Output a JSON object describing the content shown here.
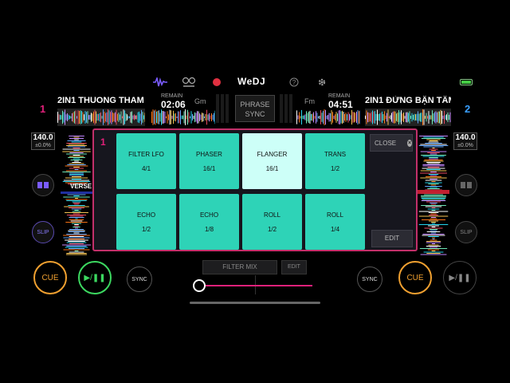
{
  "app": {
    "logo": "WeDJ"
  },
  "topbar": {
    "icons": [
      "waveform-icon",
      "automix-icon",
      "record-icon",
      "help-icon",
      "settings-icon",
      "battery-icon"
    ]
  },
  "deck1": {
    "number": "1",
    "title": "2IN1 THUONG THAM",
    "remain_label": "REMAIN",
    "remain_time": "02:06",
    "key": "Gm",
    "bpm": "140.0",
    "pitch": "±0.0%",
    "cue_label": "CUE",
    "play_label": "▶/❚❚",
    "sync_label": "SYNC",
    "slip_label": "SLIP",
    "section_label": "VERSE",
    "color": "#e0207a"
  },
  "deck2": {
    "number": "2",
    "title": "2IN1 ĐỪNG BẬN TÂM",
    "remain_label": "REMAIN",
    "remain_time": "04:51",
    "key": "Fm",
    "bpm": "140.0",
    "pitch": "±0.0%",
    "cue_label": "CUE",
    "play_label": "▶/❚❚",
    "sync_label": "SYNC",
    "slip_label": "SLIP",
    "color": "#3aa0ff"
  },
  "phrase_sync": {
    "line1": "PHRASE",
    "line2": "SYNC"
  },
  "fx_panel": {
    "deck": "1",
    "close_label": "CLOSE",
    "edit_label": "EDIT",
    "pads": [
      {
        "name": "FILTER LFO",
        "beat": "4/1",
        "active": false
      },
      {
        "name": "PHASER",
        "beat": "16/1",
        "active": false
      },
      {
        "name": "FLANGER",
        "beat": "16/1",
        "active": true
      },
      {
        "name": "TRANS",
        "beat": "1/2",
        "active": false
      },
      {
        "name": "ECHO",
        "beat": "1/2",
        "active": false
      },
      {
        "name": "ECHO",
        "beat": "1/8",
        "active": false
      },
      {
        "name": "ROLL",
        "beat": "1/2",
        "active": false
      },
      {
        "name": "ROLL",
        "beat": "1/4",
        "active": false
      }
    ]
  },
  "filter": {
    "mix_label": "FILTER MIX",
    "edit_label": "EDIT",
    "value": 0
  },
  "colors": {
    "accent": "#e0207a",
    "pad": "#2ed3b7",
    "pad_active": "#cdfff8",
    "cue": "#f0a030",
    "play_active": "#3cd860"
  }
}
